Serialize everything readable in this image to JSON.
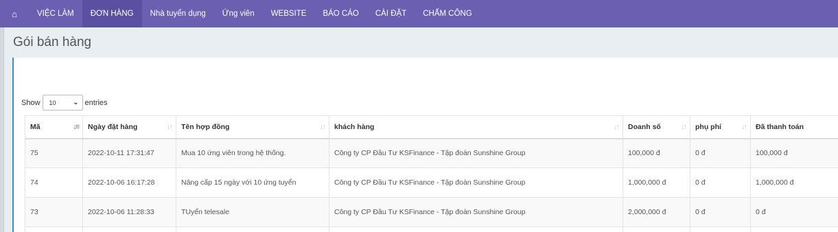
{
  "nav": {
    "home_icon": "⌂",
    "items": [
      {
        "label": "VIỆC LÀM"
      },
      {
        "label": "ĐƠN HÀNG"
      },
      {
        "label": "Nhà tuyển dụng"
      },
      {
        "label": "Ứng viên"
      },
      {
        "label": "WEBSITE"
      },
      {
        "label": "BÁO CÁO"
      },
      {
        "label": "CÀI ĐẶT"
      },
      {
        "label": "CHẤM CÔNG"
      }
    ],
    "active_index": 1
  },
  "page": {
    "title": "Gói bán hàng"
  },
  "length": {
    "show": "Show",
    "value": "10",
    "entries": "entries"
  },
  "table": {
    "columns": [
      "Mã",
      "Ngày đặt hàng",
      "Tên hợp đồng",
      "khách hàng",
      "Doanh số",
      "phụ phí",
      "Đã thanh toán"
    ],
    "rows": [
      {
        "id": "75",
        "date": "2022-10-11 17:31:47",
        "contract": "Mua 10 ứng viên trong hệ thống.",
        "customer": "Công ty CP Đầu Tư KSFinance - Tập đoàn Sunshine Group",
        "sales": "100,000 đ",
        "fee": "0 đ",
        "paid": "100,000 đ"
      },
      {
        "id": "74",
        "date": "2022-10-06 16:17:28",
        "contract": "Nâng cấp 15 ngày với 10 ứng tuyển",
        "customer": "Công ty CP Đầu Tư KSFinance - Tập đoàn Sunshine Group",
        "sales": "1,000,000 đ",
        "fee": "0 đ",
        "paid": "1,000,000 đ"
      },
      {
        "id": "73",
        "date": "2022-10-06 11:28:33",
        "contract": "TUyển telesale",
        "customer": "Công ty CP Đầu Tư KSFinance - Tập đoàn Sunshine Group",
        "sales": "2,000,000 đ",
        "fee": "0 đ",
        "paid": "0 đ"
      }
    ]
  },
  "colors": {
    "nav_bg": "#6a5fb0",
    "nav_active": "#5a4fa0",
    "link": "#3a7fc1",
    "accent_border": "#3a8dc7"
  }
}
